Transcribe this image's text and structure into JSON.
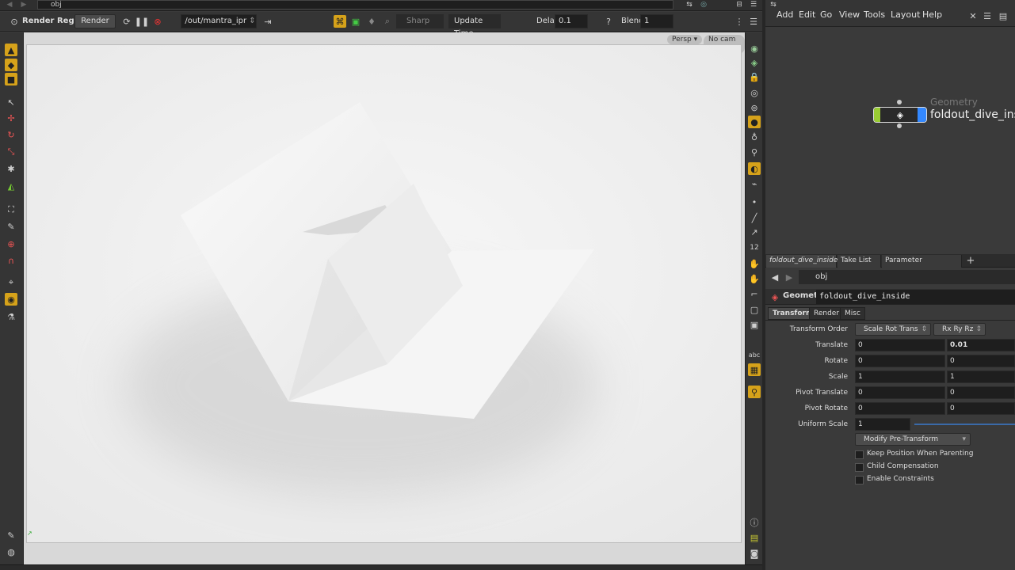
{
  "viewer": {
    "path": "obj",
    "toolbar": {
      "render_region": "Render Region",
      "render_button": "Render",
      "output": "/out/mantra_ipr",
      "sharp": "Sharp",
      "update_time": "Update Time",
      "delay_label": "Delay",
      "delay_value": "0.1",
      "blend_label": "Blend",
      "blend_value": "1"
    },
    "viewport": {
      "persp": "Persp",
      "camera": "No cam"
    }
  },
  "network": {
    "menu": [
      "Add",
      "Edit",
      "Go",
      "View",
      "Tools",
      "Layout",
      "Help"
    ],
    "node_type": "Geometry",
    "node_name": "foldout_dive_insi"
  },
  "panel_tabs": [
    "foldout_dive_inside",
    "Take List",
    "Parameter Spreadsheet"
  ],
  "params": {
    "path": "obj",
    "node_type": "Geometry",
    "node_name": "foldout_dive_inside",
    "tabs": [
      "Transform",
      "Render",
      "Misc"
    ],
    "transform_order_label": "Transform Order",
    "transform_order": "Scale Rot Trans",
    "rotate_order": "Rx Ry Rz",
    "rows": [
      {
        "label": "Translate",
        "a": "0",
        "b": "0.01"
      },
      {
        "label": "Rotate",
        "a": "0",
        "b": "0"
      },
      {
        "label": "Scale",
        "a": "1",
        "b": "1"
      },
      {
        "label": "Pivot Translate",
        "a": "0",
        "b": "0"
      },
      {
        "label": "Pivot Rotate",
        "a": "0",
        "b": "0"
      }
    ],
    "uniform_scale_label": "Uniform Scale",
    "uniform_scale": "1",
    "modify_pre_transform": "Modify Pre-Transform",
    "checkboxes": [
      "Keep Position When Parenting",
      "Child Compensation",
      "Enable Constraints"
    ]
  }
}
